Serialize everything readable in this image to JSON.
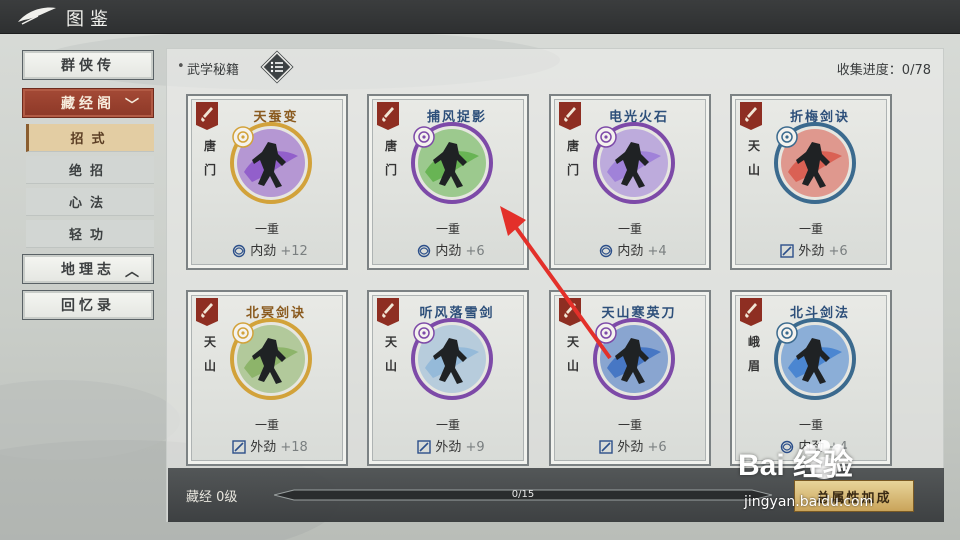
{
  "header": {
    "title": "图鉴"
  },
  "sidebar": {
    "items": [
      {
        "label": "群侠传",
        "type": "button"
      },
      {
        "label": "藏经阁",
        "type": "group-open"
      },
      {
        "label": "招式",
        "type": "sub",
        "active": true
      },
      {
        "label": "绝招",
        "type": "sub"
      },
      {
        "label": "心法",
        "type": "sub"
      },
      {
        "label": "轻功",
        "type": "sub"
      },
      {
        "label": "地理志",
        "type": "group-closed"
      },
      {
        "label": "回忆录",
        "type": "button"
      }
    ]
  },
  "panel": {
    "section_label": "武学秘籍",
    "progress_text": "收集进度：0/78"
  },
  "cards": [
    {
      "name": "天蚕变",
      "sect": "唐门",
      "level": "一重",
      "stat": "内劲",
      "bonus": "+12",
      "name_color": "#8a5a1e",
      "ring": "#d2a23a",
      "fx": "#8c55c9"
    },
    {
      "name": "捕风捉影",
      "sect": "唐门",
      "level": "一重",
      "stat": "内劲",
      "bonus": "+6",
      "name_color": "#2d4f7a",
      "ring": "#7d4aa8",
      "fx": "#5fb04a"
    },
    {
      "name": "电光火石",
      "sect": "唐门",
      "level": "一重",
      "stat": "内劲",
      "bonus": "+4",
      "name_color": "#2d4f7a",
      "ring": "#7d4aa8",
      "fx": "#9b7ad8"
    },
    {
      "name": "折梅剑诀",
      "sect": "天山",
      "level": "一重",
      "stat": "外劲",
      "bonus": "+6",
      "name_color": "#2d4f7a",
      "ring": "#3b6a8e",
      "fx": "#d9574a"
    },
    {
      "name": "北冥剑诀",
      "sect": "天山",
      "level": "一重",
      "stat": "外劲",
      "bonus": "+18",
      "name_color": "#8a5a1e",
      "ring": "#d2a23a",
      "fx": "#86b062"
    },
    {
      "name": "听风落雪剑",
      "sect": "天山",
      "level": "一重",
      "stat": "外劲",
      "bonus": "+9",
      "name_color": "#2d4f7a",
      "ring": "#7d4aa8",
      "fx": "#8fb6d8"
    },
    {
      "name": "天山寒英刀",
      "sect": "天山",
      "level": "一重",
      "stat": "外劲",
      "bonus": "+6",
      "name_color": "#2d4f7a",
      "ring": "#7d4aa8",
      "fx": "#3c6fc2"
    },
    {
      "name": "北斗剑法",
      "sect": "峨眉",
      "level": "一重",
      "stat": "内劲",
      "bonus": "+4",
      "name_color": "#2d4f7a",
      "ring": "#3b6a8e",
      "fx": "#3f7fd0"
    }
  ],
  "bottom": {
    "level_label": "藏经 0级",
    "bar_text": "0/15",
    "bar_progress": 0,
    "total_button": "总属性加成"
  },
  "watermark": {
    "brand": "Bai 经验",
    "url": "jingyan.baidu.com"
  }
}
